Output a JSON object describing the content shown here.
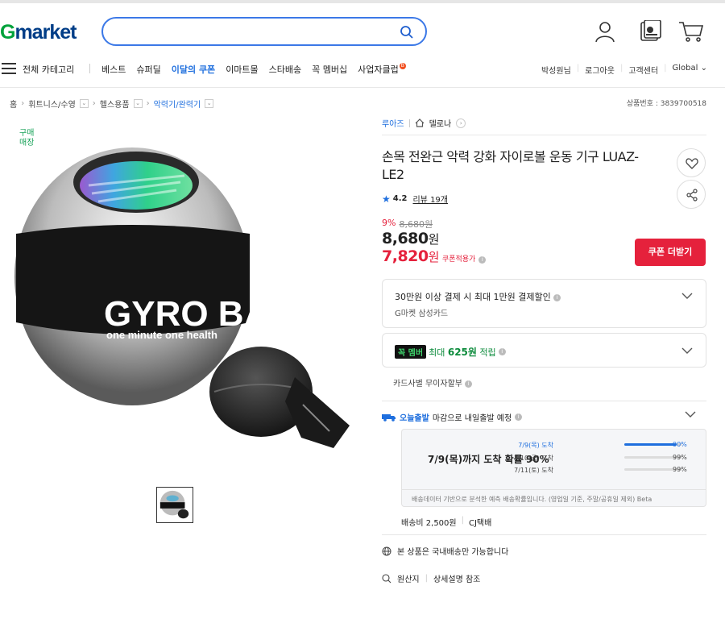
{
  "logo": {
    "g": "G",
    "market": "market"
  },
  "search": {
    "placeholder": ""
  },
  "nav": {
    "all_categories": "전체 카테고리",
    "items": [
      "베스트",
      "슈퍼딜",
      "이달의 쿠폰",
      "이마트몰",
      "스타배송",
      "꼭 멤버십",
      "사업자클럽"
    ],
    "highlight_item": "이달의 쿠폰",
    "badge": "B",
    "user": "박성원님",
    "logout": "로그아웃",
    "customer_center": "고객센터",
    "global": "Global"
  },
  "breadcrumb": [
    "홈",
    "휘트니스/수영",
    "헬스용품",
    "악력기/완력기"
  ],
  "product_number": "상품번호 : 3839700518",
  "image": {
    "buy_tag": "구매\n매장",
    "ball_text_1": "GYRO BALL",
    "ball_text_2": "one minute  one health"
  },
  "store": {
    "brand": "루아즈",
    "shop": "델로나"
  },
  "product": {
    "title": "손목 전완근 악력 강화 자이로볼 운동 기구 LUAZ-LE2",
    "rating": "4.2",
    "review_label": "리뷰 19개",
    "discount_pct": "9%",
    "original_price": "8,680원",
    "price_value": "8,680",
    "price_unit": "원",
    "coupon_price_value": "7,820",
    "coupon_price_unit": "원",
    "coupon_label": "쿠폰적용가",
    "coupon_button": "쿠폰 더받기"
  },
  "benefits": {
    "card_title": "30만원 이상 결제 시 최대 1만원 결제할인",
    "card_sub": "G마켓 삼성카드",
    "member_badge": "꼭 멤버",
    "member_text_pre": "최대",
    "member_amount": "625원",
    "member_text_post": "적립",
    "installment": "카드사별 무이자할부"
  },
  "shipping": {
    "today_label": "오늘출발",
    "today_text": "마감으로 내일출발 예정",
    "headline": "7/9(목)까지 도착 확률 90%",
    "predictions": [
      {
        "date": "7/9(목) 도착",
        "pct": "90%",
        "fill": 0.9,
        "active": true
      },
      {
        "date": "7/10(금) 도착",
        "pct": "99%",
        "fill": 0.0,
        "active": false
      },
      {
        "date": "7/11(토) 도착",
        "pct": "99%",
        "fill": 0.0,
        "active": false
      }
    ],
    "note": "배송데이터 기반으로 분석한 예측 배송확률입니다. (영업일 기준, 주말/공휴일 제외) Beta",
    "fee": "배송비 2,500원",
    "carrier": "CJ택배",
    "domestic": "본 상품은 국내배송만 가능합니다",
    "origin": "원산지",
    "origin_detail": "상세설명 참조"
  }
}
